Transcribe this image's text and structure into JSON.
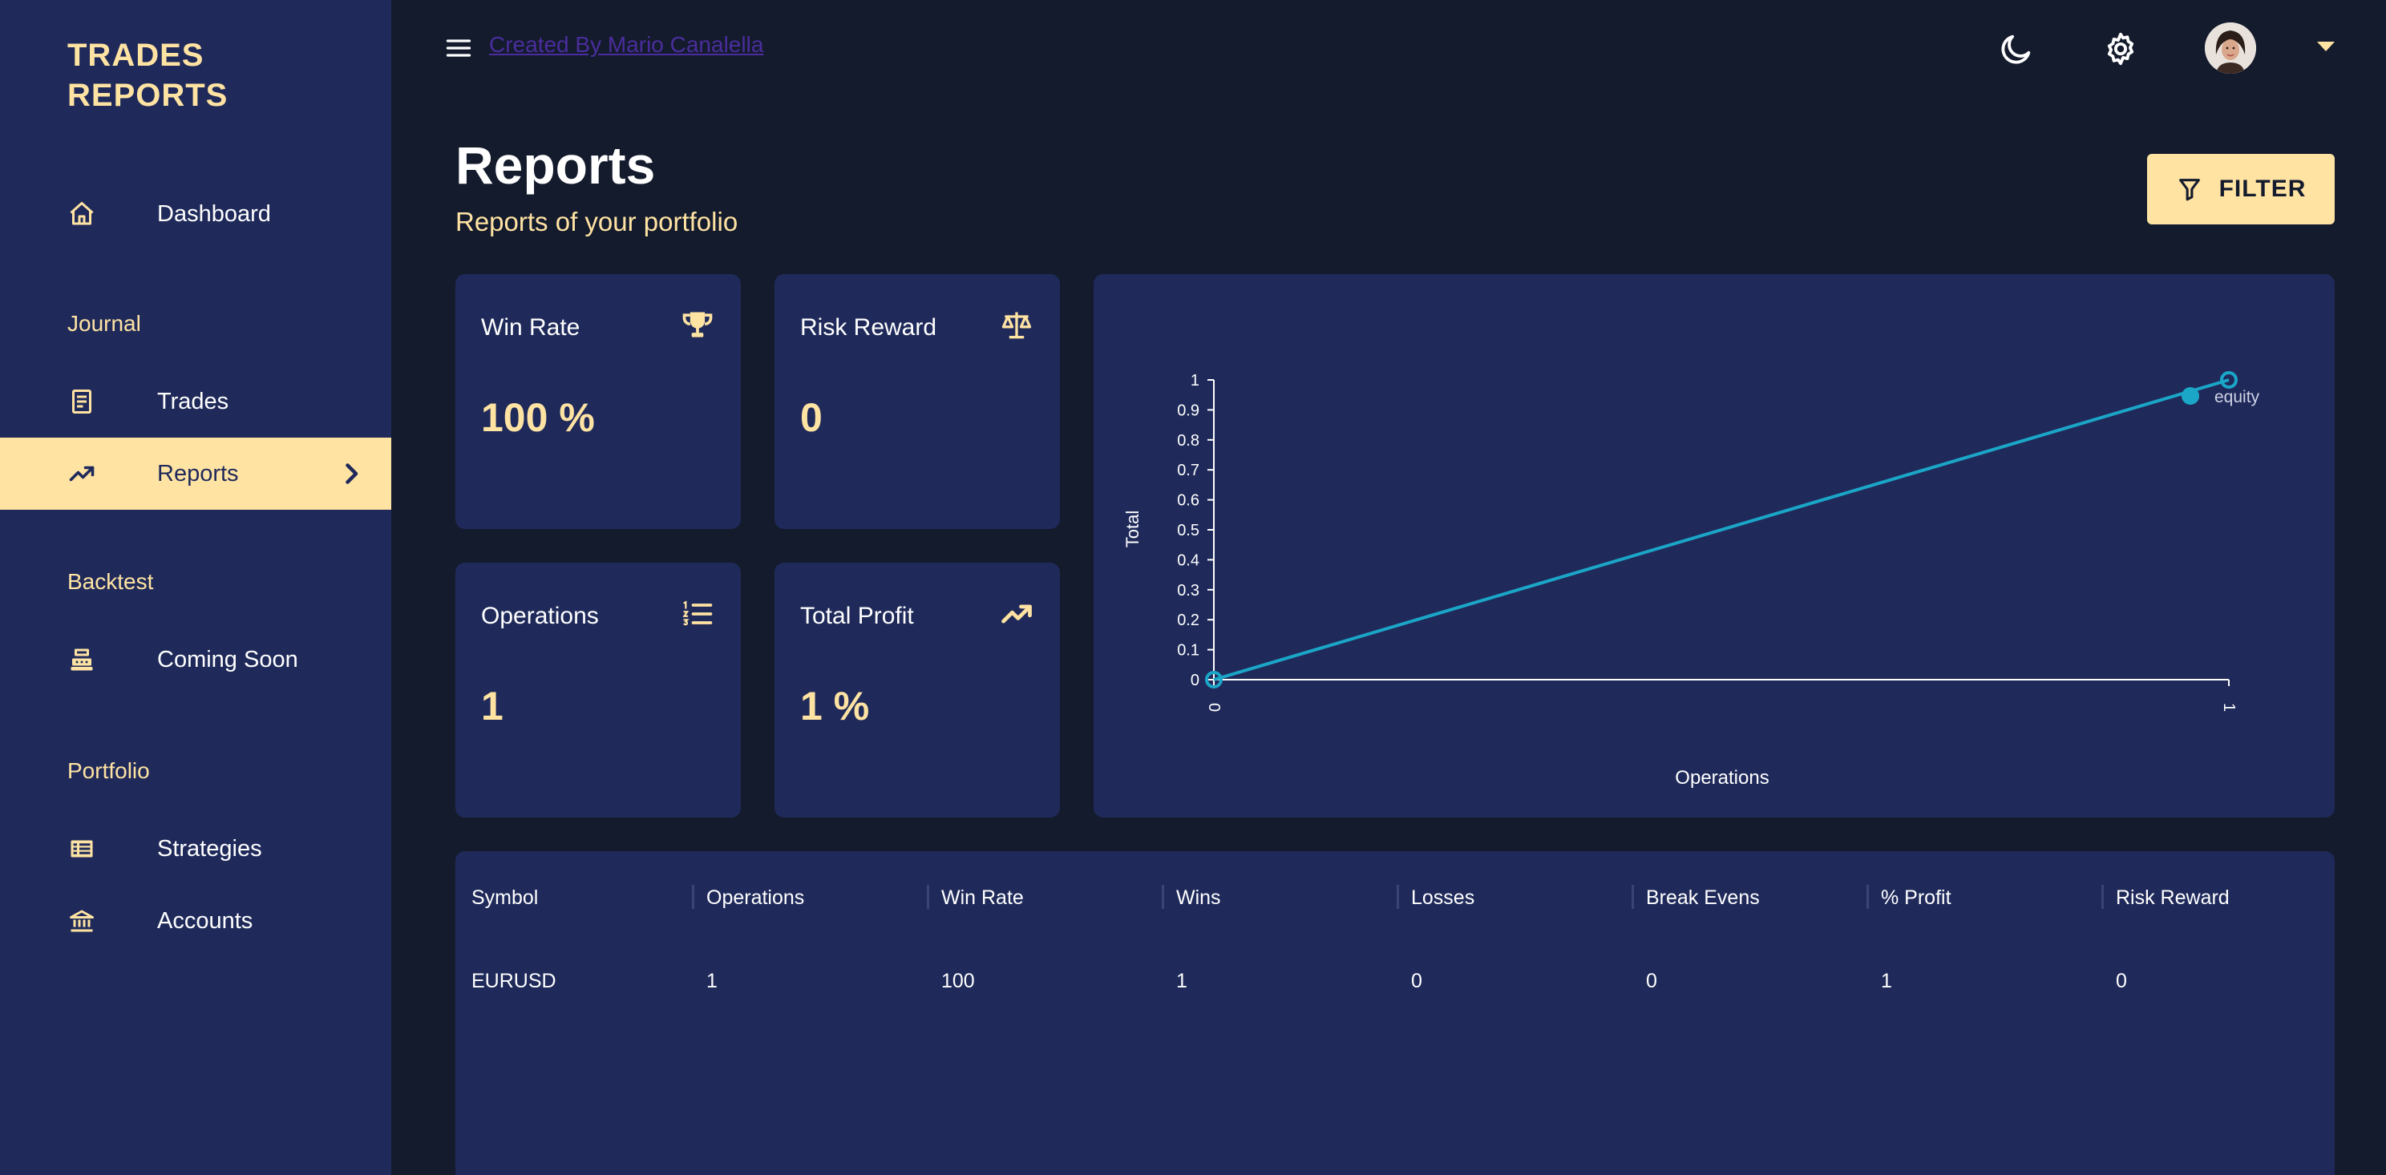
{
  "app": {
    "brand": "TRADES\nREPORTS"
  },
  "topbar": {
    "credit_link": "Created By Mario Canalella"
  },
  "sidebar": {
    "dashboard": "Dashboard",
    "journal_title": "Journal",
    "trades": "Trades",
    "reports": "Reports",
    "backtest_title": "Backtest",
    "coming_soon": "Coming Soon",
    "portfolio_title": "Portfolio",
    "strategies": "Strategies",
    "accounts": "Accounts"
  },
  "header": {
    "title": "Reports",
    "subtitle": "Reports of your portfolio",
    "filter_label": "FILTER"
  },
  "stats": {
    "win_rate": {
      "label": "Win Rate",
      "value": "100 %"
    },
    "risk_reward": {
      "label": "Risk Reward",
      "value": "0"
    },
    "operations": {
      "label": "Operations",
      "value": "1"
    },
    "total_profit": {
      "label": "Total Profit",
      "value": "1 %"
    }
  },
  "colors": {
    "accent": "#ffe3a3",
    "panel": "#1f2a5a",
    "background": "#141b2d",
    "series": "#1ba6c8"
  },
  "chart_data": {
    "type": "line",
    "title": "",
    "xlabel": "Operations",
    "ylabel": "Total",
    "x": [
      0,
      1
    ],
    "x_ticks": [
      "0",
      "1"
    ],
    "y_ticks": [
      "0",
      "0.1",
      "0.2",
      "0.3",
      "0.4",
      "0.5",
      "0.6",
      "0.7",
      "0.8",
      "0.9",
      "1"
    ],
    "xlim": [
      0,
      1
    ],
    "ylim": [
      0,
      1
    ],
    "grid": false,
    "legend": "top-right",
    "series": [
      {
        "name": "equity",
        "values": [
          0,
          1
        ]
      }
    ]
  },
  "table": {
    "headers": [
      "Symbol",
      "Operations",
      "Win Rate",
      "Wins",
      "Losses",
      "Break Evens",
      "% Profit",
      "Risk Reward"
    ],
    "rows": [
      [
        "EURUSD",
        "1",
        "100",
        "1",
        "0",
        "0",
        "1",
        "0"
      ]
    ]
  }
}
